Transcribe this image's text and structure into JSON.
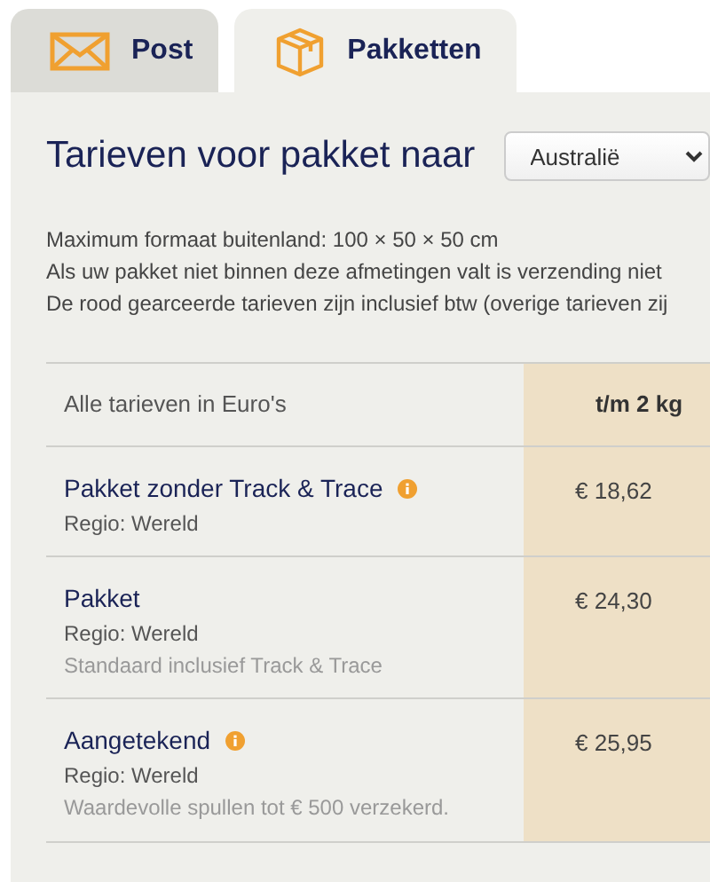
{
  "tabs": [
    {
      "label": "Post",
      "selected": false
    },
    {
      "label": "Pakketten",
      "selected": true
    }
  ],
  "heading": "Tarieven voor pakket naar",
  "destination": {
    "value": "Australië"
  },
  "notes": [
    "Maximum formaat buitenland: 100 × 50 × 50 cm",
    "Als uw pakket niet binnen deze afmetingen valt is verzending niet",
    "De rood gearceerde tarieven zijn inclusief btw (overige tarieven zij"
  ],
  "table": {
    "columns": [
      "Alle tarieven in Euro's",
      "t/m 2 kg"
    ],
    "rows": [
      {
        "name": "Pakket zonder Track & Trace",
        "info": true,
        "region": "Regio: Wereld",
        "price": "€ 18,62"
      },
      {
        "name": "Pakket",
        "info": false,
        "region": "Regio: Wereld",
        "note": "Standaard inclusief Track & Trace",
        "price": "€ 24,30"
      },
      {
        "name": "Aangetekend",
        "info": true,
        "region": "Regio: Wereld",
        "note": "Waardevolle spullen tot € 500 verzekerd.",
        "price": "€ 25,95"
      }
    ]
  }
}
